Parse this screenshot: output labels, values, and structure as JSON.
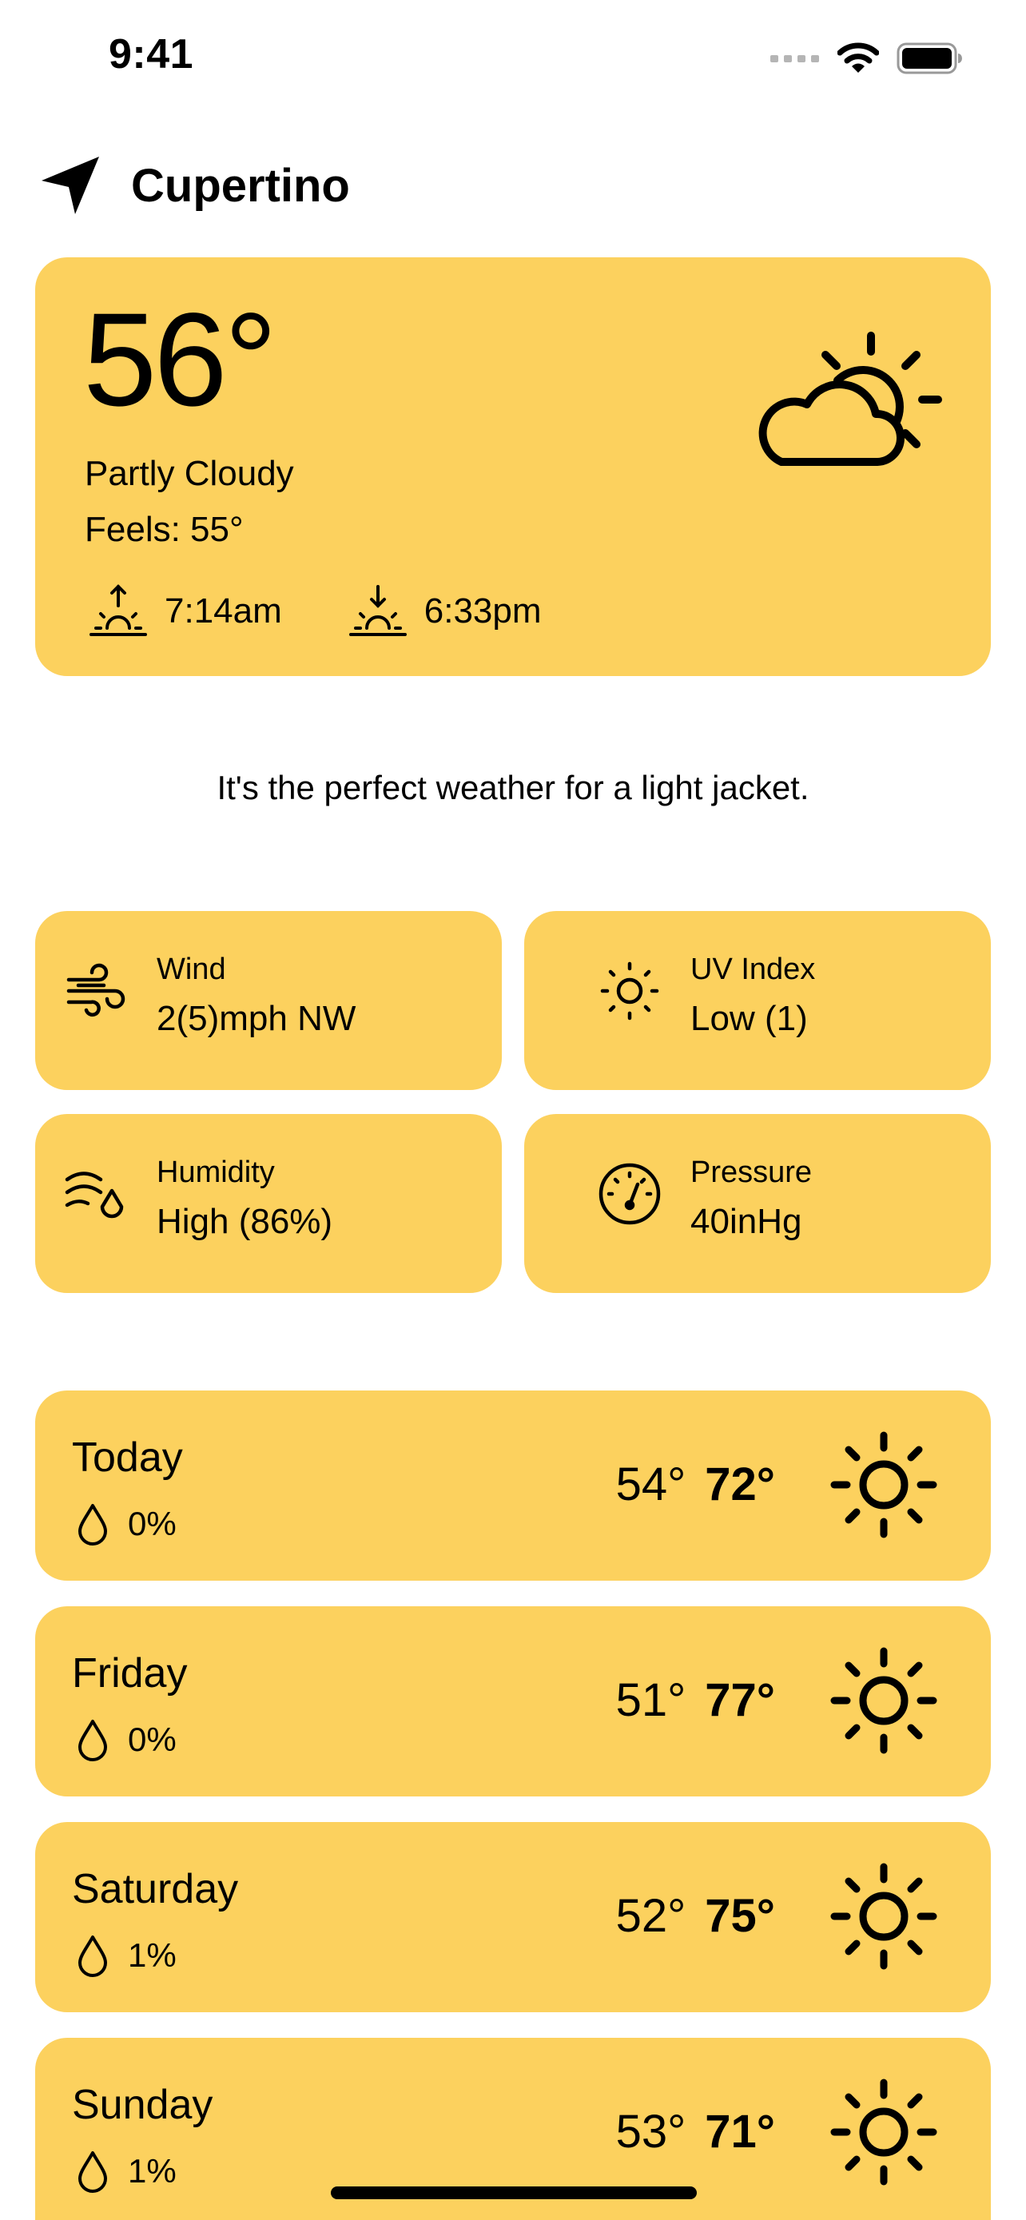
{
  "status_bar": {
    "time": "9:41"
  },
  "header": {
    "city": "Cupertino",
    "location_icon": "location-arrow-icon"
  },
  "current": {
    "temperature": "56°",
    "condition": "Partly Cloudy",
    "feels_like": "Feels: 55°",
    "sunrise": "7:14am",
    "sunset": "6:33pm",
    "condition_icon": "partly-cloudy-icon"
  },
  "tip": "It's the perfect weather for a light jacket.",
  "details": {
    "wind": {
      "label": "Wind",
      "value": "2(5)mph NW",
      "icon": "wind-icon"
    },
    "uv": {
      "label": "UV Index",
      "value": "Low (1)",
      "icon": "sun-small-icon"
    },
    "humidity": {
      "label": "Humidity",
      "value": "High (86%)",
      "icon": "humidity-icon"
    },
    "pressure": {
      "label": "Pressure",
      "value": "40inHg",
      "icon": "gauge-icon"
    }
  },
  "forecast": [
    {
      "day": "Today",
      "rain": "0%",
      "low": "54°",
      "high": "72°",
      "icon": "sun-icon"
    },
    {
      "day": "Friday",
      "rain": "0%",
      "low": "51°",
      "high": "77°",
      "icon": "sun-icon"
    },
    {
      "day": "Saturday",
      "rain": "1%",
      "low": "52°",
      "high": "75°",
      "icon": "sun-icon"
    },
    {
      "day": "Sunday",
      "rain": "1%",
      "low": "53°",
      "high": "71°",
      "icon": "sun-icon"
    }
  ],
  "colors": {
    "card": "#FCD15E",
    "text": "#000000",
    "background": "#FFFFFF",
    "signal_dots": "#B5B5B5"
  }
}
